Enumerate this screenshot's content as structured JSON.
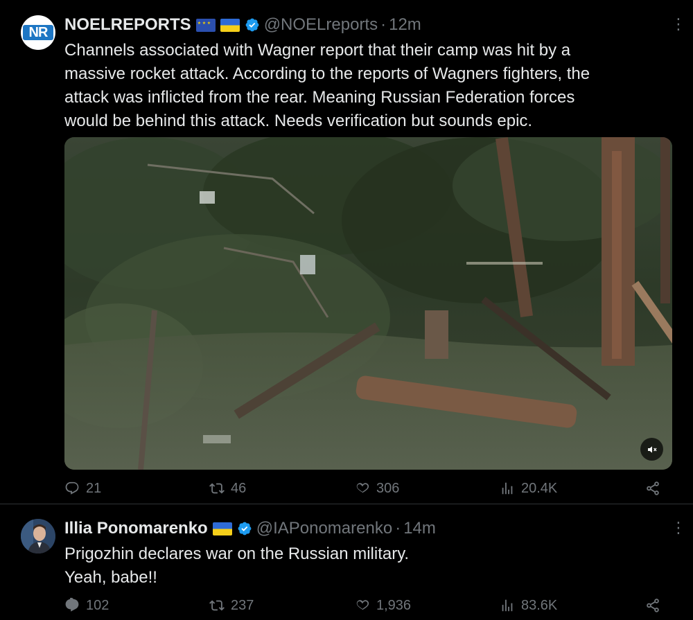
{
  "tweets": [
    {
      "author_name": "NOELREPORTS",
      "avatar_text": "NR",
      "handle": "@NOELreports",
      "time": "12m",
      "text_lines": [
        "Channels associated with Wagner report that their camp was hit by a",
        "massive rocket attack. According to the reports of Wagners fighters, the",
        "attack was inflicted from the rear. Meaning Russian Federation forces",
        "would be behind this attack. Needs verification but sounds epic."
      ],
      "flags": [
        "eu-flag-icon",
        "ukraine-flag-icon"
      ],
      "media": {
        "type": "video",
        "mute_icon": "speaker-muted-icon"
      },
      "stats": {
        "replies": "21",
        "retweets": "46",
        "likes": "306",
        "views": "20.4K"
      }
    },
    {
      "author_name": "Illia Ponomarenko",
      "handle": "@IAPonomarenko",
      "time": "14m",
      "text_lines": [
        "Prigozhin declares war on the Russian military.",
        "Yeah, babe!!"
      ],
      "flags": [
        "ukraine-flag-icon"
      ],
      "stats": {
        "replies": "102",
        "retweets": "237",
        "likes": "1,936",
        "views": "83.6K"
      }
    }
  ],
  "colors": {
    "background": "#000000",
    "text": "#e7e9ea",
    "muted": "#71767b",
    "verified": "#1d9bf0",
    "divider": "#2f3336"
  }
}
